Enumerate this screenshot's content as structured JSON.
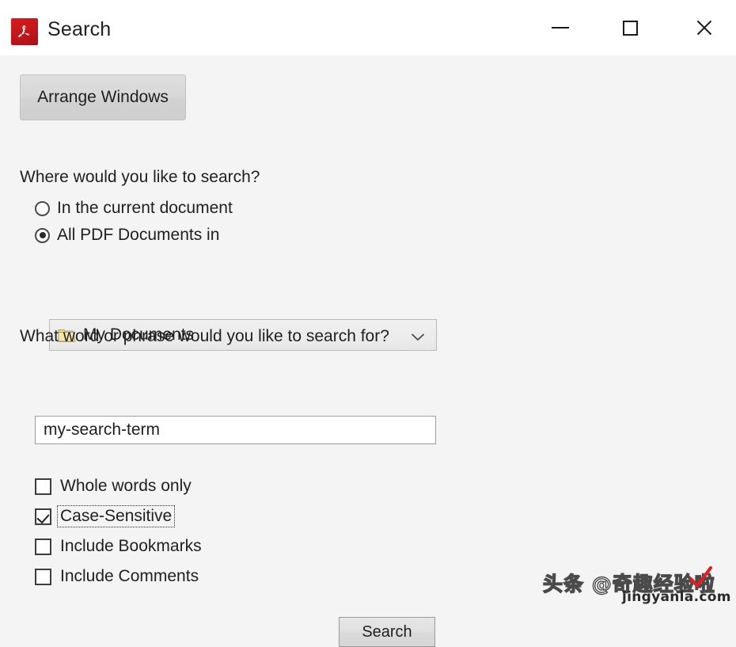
{
  "window": {
    "title": "Search",
    "app_icon": "adobe-acrobat-icon",
    "controls": {
      "minimize": "minimize-icon",
      "maximize": "maximize-icon",
      "close": "close-icon"
    }
  },
  "toolbar": {
    "arrange_windows_label": "Arrange Windows"
  },
  "scope": {
    "question": "Where would you like to search?",
    "options": [
      {
        "label": "In the current document",
        "selected": false
      },
      {
        "label": "All PDF Documents in",
        "selected": true
      }
    ],
    "folder_dropdown": {
      "value": "My Documents",
      "icon": "folder-icon",
      "chevron": "chevron-down-icon"
    }
  },
  "query": {
    "question": "What word or phrase would you like to search for?",
    "value": "my-search-term",
    "placeholder": ""
  },
  "options": [
    {
      "label": "Whole words only",
      "checked": false,
      "focused": false
    },
    {
      "label": "Case-Sensitive",
      "checked": true,
      "focused": true
    },
    {
      "label": "Include Bookmarks",
      "checked": false,
      "focused": false
    },
    {
      "label": "Include Comments",
      "checked": false,
      "focused": false
    }
  ],
  "actions": {
    "search_label": "Search"
  },
  "watermark": {
    "main": "头条 @奇趣经验啦",
    "sub": "jingyanla.com",
    "check_color": "#e02020"
  },
  "colors": {
    "titlebar_bg": "#ffffff",
    "body_bg": "#f4f4f4",
    "accent_red": "#c0161b",
    "text": "#1f1f1f"
  }
}
